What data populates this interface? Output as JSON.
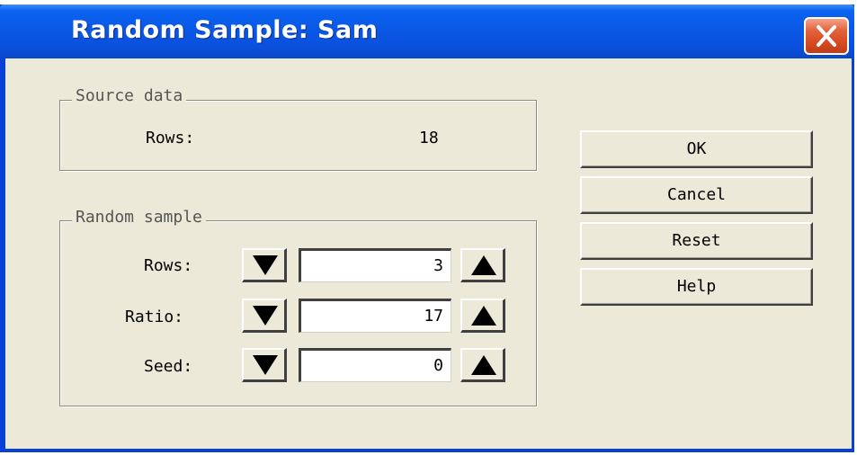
{
  "window": {
    "title": "Random Sample: Sam"
  },
  "source_data": {
    "legend": "Source data",
    "rows_label": "Rows:",
    "rows_value": "18"
  },
  "random_sample": {
    "legend": "Random sample",
    "fields": [
      {
        "label": "Rows:",
        "value": "3"
      },
      {
        "label": "Ratio:",
        "value": "17"
      },
      {
        "label": "Seed:",
        "value": "0"
      }
    ]
  },
  "buttons": {
    "ok": "OK",
    "cancel": "Cancel",
    "reset": "Reset",
    "help": "Help"
  },
  "icons": {
    "close": "close-icon",
    "decrement": "down-triangle-icon",
    "increment": "up-triangle-icon"
  },
  "colors": {
    "titlebar": "#0a58e6",
    "dialog_background": "#ece9d8",
    "close_button": "#d64a22"
  }
}
